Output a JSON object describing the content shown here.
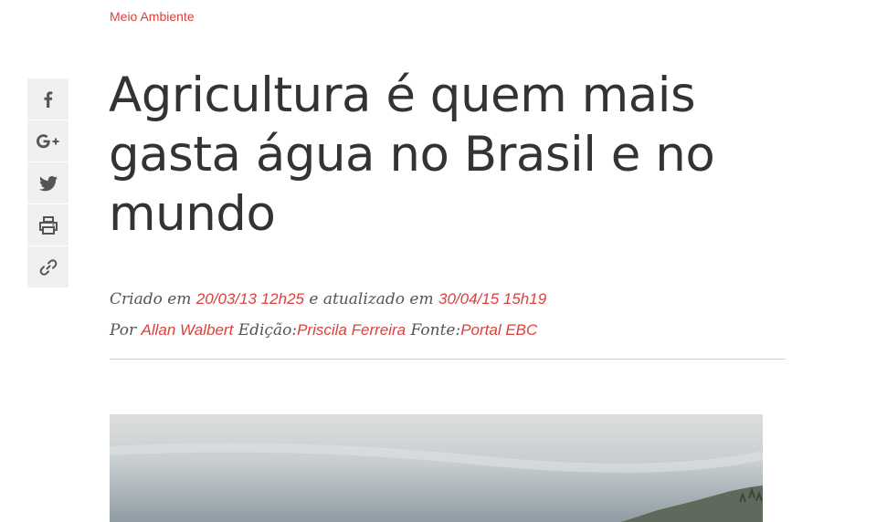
{
  "category": "Meio Ambiente",
  "share": {
    "icons": [
      "facebook-icon",
      "google-plus-icon",
      "twitter-icon",
      "print-icon",
      "link-icon"
    ],
    "icon_color": "#555555",
    "background": "#f0f0f0"
  },
  "article": {
    "title": "Agricultura é quem mais gasta água no Brasil e no mundo",
    "created_label": "Criado em",
    "created_value": "20/03/13 12h25",
    "updated_label": "e atualizado em",
    "updated_value": "30/04/15 15h19",
    "by_label": "Por",
    "author": "Allan Walbert",
    "edition_label": "Edição:",
    "editor": "Priscila Ferreira",
    "source_label": "Fonte:",
    "source": "Portal EBC"
  },
  "colors": {
    "accent": "#d9423f",
    "text": "#333333",
    "divider": "#cfcfcf"
  }
}
